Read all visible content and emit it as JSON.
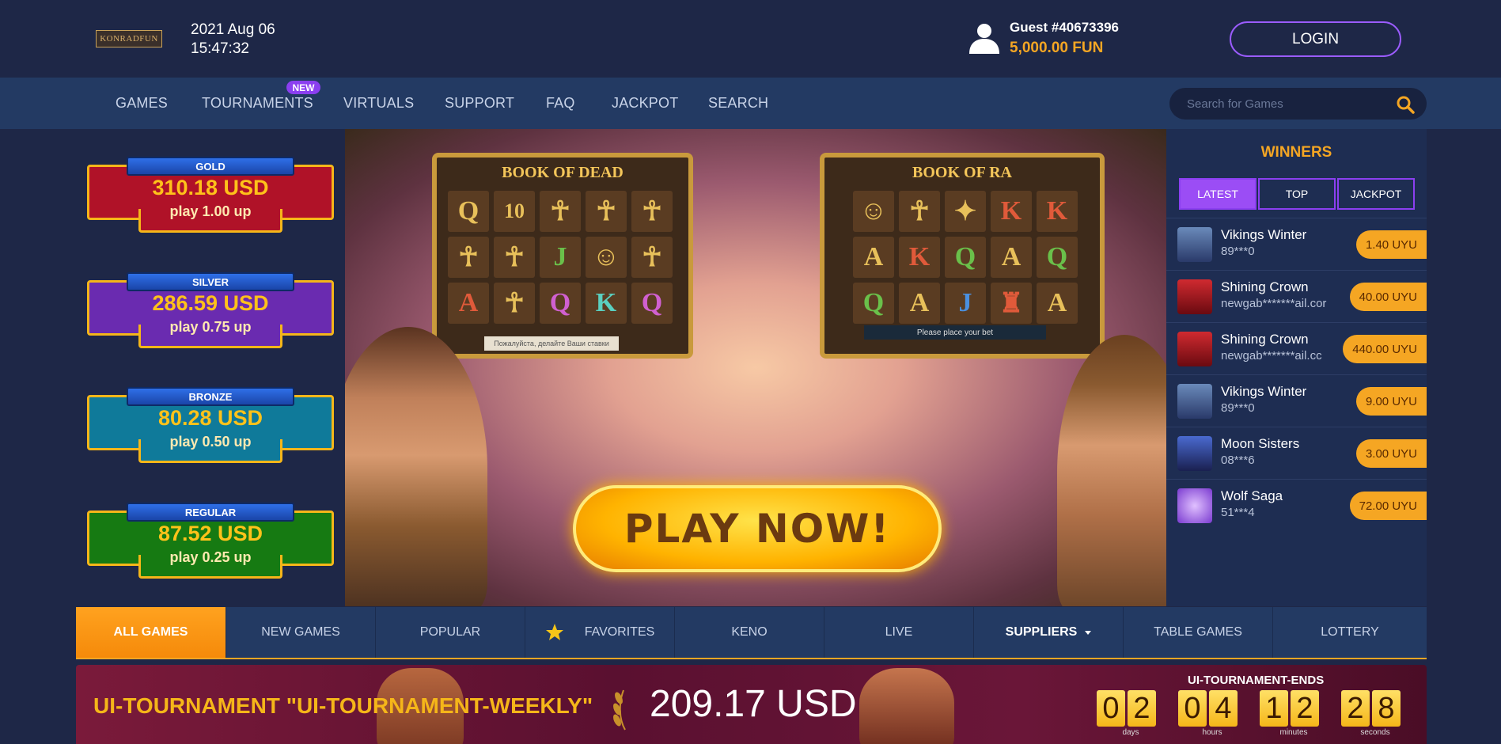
{
  "header": {
    "logo_text": "KONRADFUN",
    "date": "2021 Aug 06",
    "time": "15:47:32",
    "guest_name": "Guest #40673396",
    "guest_balance": "5,000.00 FUN",
    "login_label": "LOGIN"
  },
  "nav": {
    "items": [
      "GAMES",
      "TOURNAMENTS",
      "VIRTUALS",
      "SUPPORT",
      "FAQ",
      "JACKPOT",
      "SEARCH"
    ],
    "new_badge": "NEW",
    "search_placeholder": "Search for Games"
  },
  "jackpots": [
    {
      "tier": "GOLD",
      "amount": "310.18 USD",
      "play": "play 1.00 up",
      "color": "#b01228"
    },
    {
      "tier": "SILVER",
      "amount": "286.59 USD",
      "play": "play 0.75 up",
      "color": "#6a2bb0"
    },
    {
      "tier": "BRONZE",
      "amount": "80.28 USD",
      "play": "play 0.50 up",
      "color": "#0f7a9a"
    },
    {
      "tier": "REGULAR",
      "amount": "87.52 USD",
      "play": "play 0.25 up",
      "color": "#167a12"
    }
  ],
  "banner": {
    "game_left": "BOOK OF DEAD",
    "game_right": "BOOK OF RA",
    "right_status": "Please place your bet",
    "left_status": "Пожалуйста, делайте Ваши ставки",
    "cta": "PLAY NOW!"
  },
  "winners": {
    "title": "WINNERS",
    "tabs": [
      "LATEST",
      "TOP",
      "JACKPOT"
    ],
    "rows": [
      {
        "game": "Vikings Winter",
        "user": "89***0",
        "amount": "1.40 UYU",
        "thumb_color": "#4a6a9a"
      },
      {
        "game": "Shining Crown",
        "user": "newgab*******ail.cor",
        "amount": "40.00 UYU",
        "thumb_color": "#a01820"
      },
      {
        "game": "Shining Crown",
        "user": "newgab*******ail.cc",
        "amount": "440.00 UYU",
        "thumb_color": "#a01820"
      },
      {
        "game": "Vikings Winter",
        "user": "89***0",
        "amount": "9.00 UYU",
        "thumb_color": "#4a6a9a"
      },
      {
        "game": "Moon Sisters",
        "user": "08***6",
        "amount": "3.00 UYU",
        "thumb_color": "#2a3a7a"
      },
      {
        "game": "Wolf Saga",
        "user": "51***4",
        "amount": "72.00 UYU",
        "thumb_color": "#8a5ad0"
      }
    ]
  },
  "categories": [
    "ALL GAMES",
    "NEW GAMES",
    "POPULAR",
    "FAVORITES",
    "KENO",
    "LIVE",
    "SUPPLIERS",
    "TABLE GAMES",
    "LOTTERY"
  ],
  "tournament": {
    "title": "UI-TOURNAMENT \"UI-TOURNAMENT-WEEKLY\"",
    "amount": "209.17 USD",
    "ends_label": "UI-TOURNAMENT-ENDS",
    "digits": [
      "0",
      "2",
      "0",
      "4",
      "1",
      "2",
      "2",
      "8"
    ],
    "units": [
      "days",
      "hours",
      "minutes",
      "seconds"
    ]
  }
}
